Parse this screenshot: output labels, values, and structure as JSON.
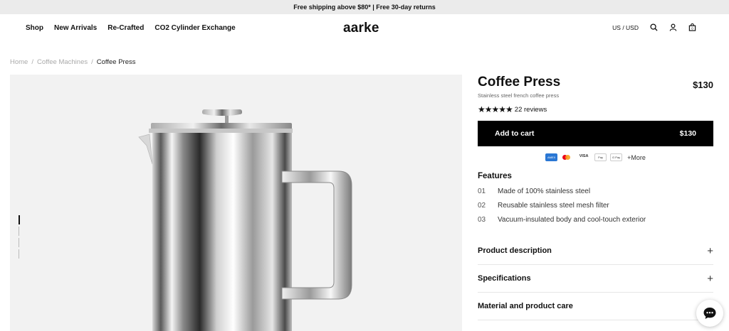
{
  "announcement": "Free shipping above $80* | Free 30-day returns",
  "nav": {
    "links": [
      "Shop",
      "New Arrivals",
      "Re-Crafted",
      "CO2 Cylinder Exchange"
    ],
    "logo": "aarke",
    "locale": "US / USD",
    "icons": [
      "search-icon",
      "account-icon",
      "cart-icon"
    ]
  },
  "breadcrumb": [
    "Home",
    "/",
    "Coffee Machines",
    "/",
    "Coffee Press"
  ],
  "product": {
    "title": "Coffee Press",
    "subtitle": "Stainless steel french coffee press",
    "price": "$130",
    "stars": "★★★★★",
    "reviews": "22 reviews",
    "cart_label": "Add to cart",
    "cart_price": "$130",
    "payments": {
      "amex": "AMEX",
      "visa": "VISA",
      "apple": "Pay",
      "gpay": "G Pay",
      "more": "+More"
    },
    "features_title": "Features",
    "features": [
      {
        "num": "01",
        "text": "Made of 100% stainless steel"
      },
      {
        "num": "02",
        "text": "Reusable stainless steel mesh filter"
      },
      {
        "num": "03",
        "text": "Vacuum-insulated body and cool-touch exterior"
      }
    ],
    "accordions": [
      "Product description",
      "Specifications",
      "Material and product care"
    ]
  },
  "colors": {
    "accent": "#000000",
    "banner": "#ebebeb",
    "gallery_bg": "#f2f2f2"
  }
}
